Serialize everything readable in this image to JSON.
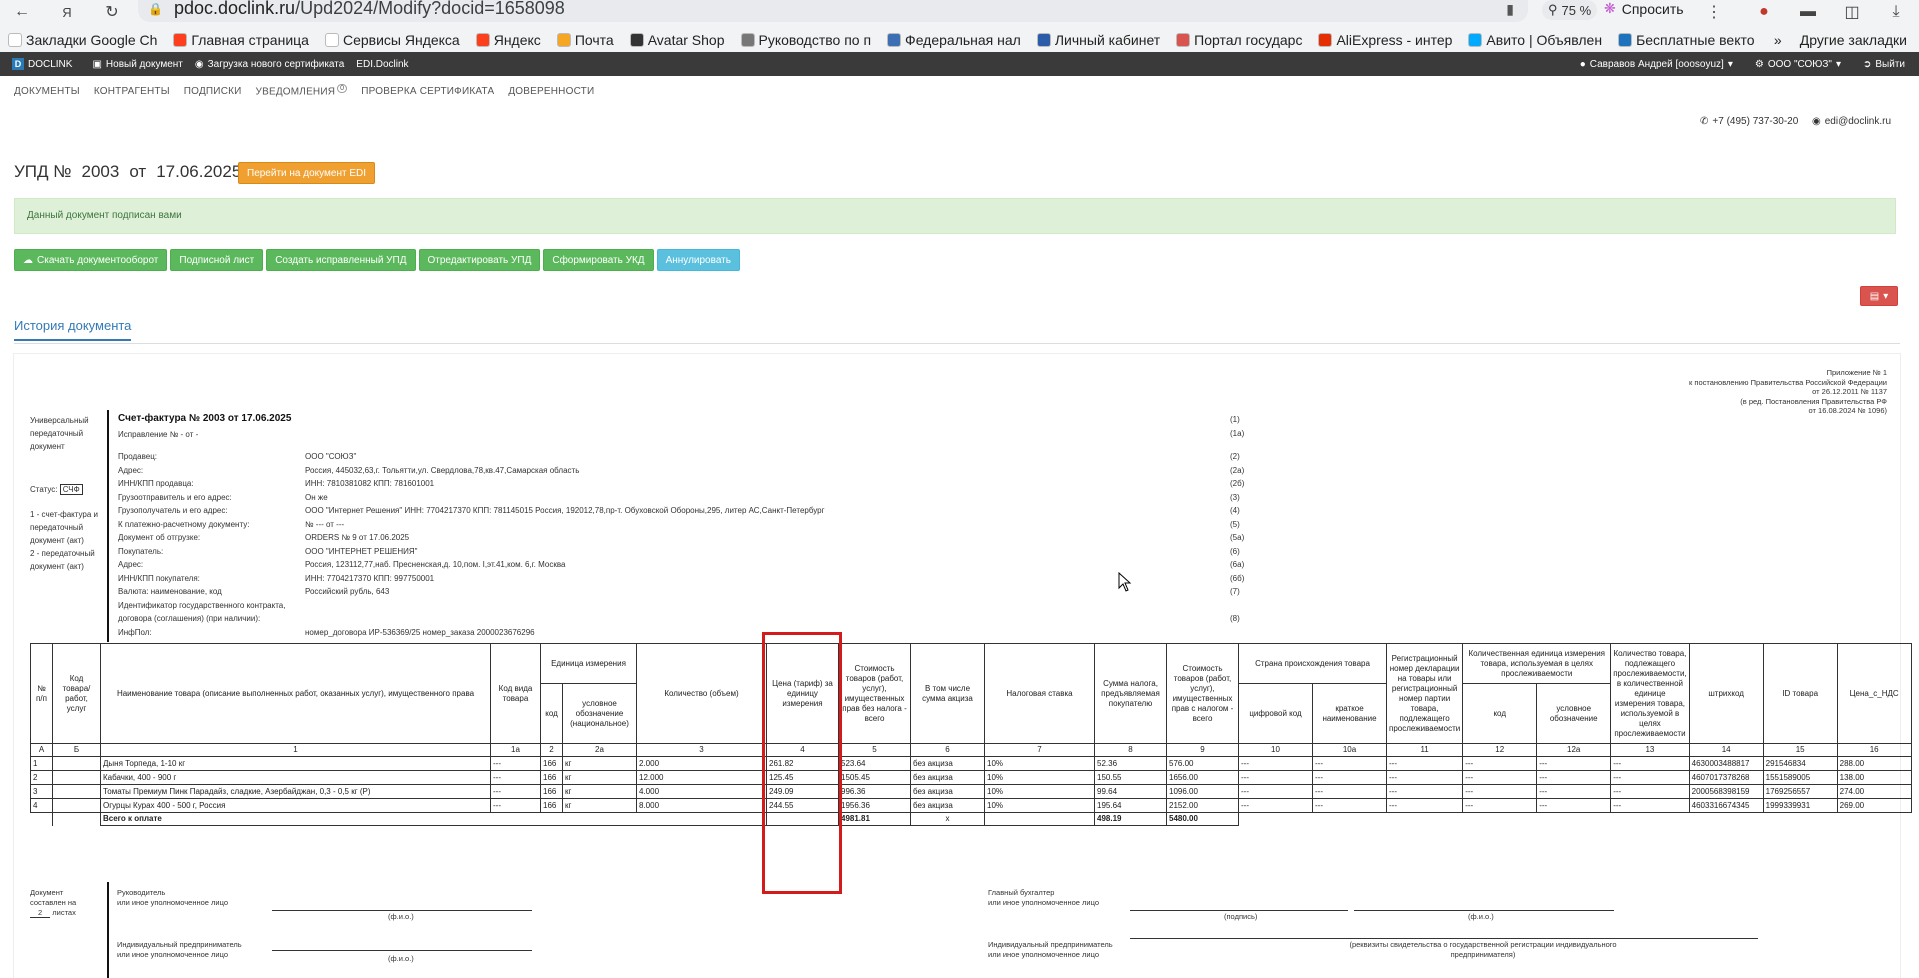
{
  "browser": {
    "url_host": "pdoc.doclink.ru",
    "url_path": "/Upd2024/Modify?docid=1658098",
    "zoom": "75 %",
    "ask_label": "Спросить",
    "bookmarks": [
      {
        "label": "Закладки Google Ch",
        "color": "#ffffff"
      },
      {
        "label": "Главная страница",
        "color": "#fc3f1d"
      },
      {
        "label": "Сервисы Яндекса",
        "color": "#ffffff"
      },
      {
        "label": "Яндекс",
        "color": "#fc3f1d"
      },
      {
        "label": "Почта",
        "color": "#f5a623"
      },
      {
        "label": "Avatar Shop",
        "color": "#333333"
      },
      {
        "label": "Руководство по п",
        "color": "#777777"
      },
      {
        "label": "Федеральная нал",
        "color": "#3c6eb4"
      },
      {
        "label": "Личный кабинет",
        "color": "#2a5caa"
      },
      {
        "label": "Портал государс",
        "color": "#d9534f"
      },
      {
        "label": "AliExpress - интер",
        "color": "#e62e04"
      },
      {
        "label": "Авито | Объявлен",
        "color": "#00aaff"
      },
      {
        "label": "Бесплатные векто",
        "color": "#1e73be"
      }
    ],
    "other_bookmarks": "Другие закладки"
  },
  "app": {
    "logo": "DOCLINK",
    "top_links": [
      "Новый документ",
      "Загрузка нового сертификата",
      "EDI.Doclink"
    ],
    "user": "Савравов Андрей [ooosoyuz]",
    "org": "ООО \"СОЮЗ\"",
    "logout": "Выйти",
    "menu": [
      "ДОКУМЕНТЫ",
      "КОНТРАГЕНТЫ",
      "ПОДПИСКИ",
      "УВЕДОМЛЕНИЯ",
      "ПРОВЕРКА СЕРТИФИКАТА",
      "ДОВЕРЕННОСТИ"
    ],
    "notifications_count": "0",
    "phone": "+7 (495) 737-30-20",
    "email": "edi@doclink.ru"
  },
  "doc": {
    "type": "УПД №",
    "number": "2003",
    "from": "от",
    "date": "17.06.2025",
    "goto_button": "Перейти на документ EDI",
    "alert": "Данный документ подписан вами",
    "actions": [
      {
        "label": "Скачать документооборот",
        "style": "g",
        "icon": "cloud-download-icon"
      },
      {
        "label": "Подписной лист",
        "style": "g"
      },
      {
        "label": "Создать исправленный УПД",
        "style": "g"
      },
      {
        "label": "Отредактировать УПД",
        "style": "g"
      },
      {
        "label": "Сформировать УКД",
        "style": "g"
      },
      {
        "label": "Аннулировать",
        "style": "b"
      }
    ],
    "history_tab": "История документа"
  },
  "invoice": {
    "appendix": [
      "Приложение № 1",
      "к постановлению Правительства Российской Федерации",
      "от 26.12.2011 № 1137",
      "(в ред. Постановления Правительства РФ",
      "от 16.08.2024 № 1096)"
    ],
    "side_label": "Универсальный передаточный документ",
    "status_label": "Статус:",
    "status_value": "СЧФ",
    "status_legend": [
      "1 - счет-фактура и передаточный документ (акт)",
      "2 - передаточный документ (акт)"
    ],
    "title": "Счет-фактура № 2003  от 17.06.2025",
    "correction": "Исправление № - от -",
    "fields": [
      {
        "label": "Продавец:",
        "value": "ООО \"СОЮЗ\"",
        "code": "(2)"
      },
      {
        "label": "Адрес:",
        "value": "Россия, 445032,63,г. Тольятти,ул. Свердлова,78,кв.47,Самарская область",
        "code": "(2а)"
      },
      {
        "label": "ИНН/КПП продавца:",
        "value": "ИНН: 7810381082 КПП: 781601001",
        "code": "(2б)"
      },
      {
        "label": "Грузоотправитель и его адрес:",
        "value": "Он же",
        "code": "(3)"
      },
      {
        "label": "Грузополучатель и его адрес:",
        "value": "ООО \"Интернет Решения\" ИНН: 7704217370 КПП: 781145015 Россия, 192012,78,пр-т. Обуховской Обороны,295, литер АС,Санкт-Петербург",
        "code": "(4)"
      },
      {
        "label": "К платежно-расчетному документу:",
        "value": "№   ---  от   ---",
        "code": "(5)"
      },
      {
        "label": "Документ об отгрузке:",
        "value": "ORDERS  № 9  от 17.06.2025",
        "code": "(5а)"
      },
      {
        "label": "Покупатель:",
        "value": "ООО \"ИНТЕРНЕТ РЕШЕНИЯ\"",
        "code": "(6)"
      },
      {
        "label": "Адрес:",
        "value": "Россия, 123112,77,наб. Пресненская,д. 10,пом. I,эт.41,ком. 6,г. Москва",
        "code": "(6а)"
      },
      {
        "label": "ИНН/КПП покупателя:",
        "value": "ИНН: 7704217370 КПП: 997750001",
        "code": "(6б)"
      },
      {
        "label": "Валюта: наименование, код",
        "value": "Российский рубль,  643",
        "code": "(7)"
      },
      {
        "label": "Идентификатор государственного контракта,",
        "value": "",
        "code": ""
      },
      {
        "label": "договора (соглашения) (при наличии):",
        "value": "",
        "code": "(8)"
      },
      {
        "label": "ИнфПол:",
        "value": "номер_договора ИР-536369/25 номер_заказа 2000023676296",
        "code": ""
      }
    ],
    "code_1": "(1)",
    "code_1a": "(1а)",
    "headers": {
      "n": "№ п/п",
      "kod": "Код товара/ работ, услуг",
      "name": "Наименование товара (описание выполненных работ, оказанных услуг), имущественного права",
      "kodvida": "Код вида товара",
      "unit": "Единица измерения",
      "unit_code": "код",
      "unit_name": "условное обозначение (национальное)",
      "qty": "Количество (объем)",
      "price": "Цена (тариф) за единицу измерения",
      "cost": "Стоимость товаров (работ, услуг), имущественных прав без налога - всего",
      "excise": "В том числе сумма акциза",
      "rate": "Налоговая ставка",
      "tax": "Сумма налога, предъявляемая покупателю",
      "total": "Стоимость товаров (работ, услуг), имущественных прав с налогом - всего",
      "country": "Страна происхождения товара",
      "country_code": "цифровой код",
      "country_name": "краткое наименование",
      "regnum": "Регистрационный номер декларации на товары или регистрационный номер партии товара, подлежащего прослеживаемости",
      "trace_unit": "Количественная единица измерения товара, используемая в целях прослеживаемости",
      "trace_code": "код",
      "trace_name": "условное обозначение",
      "trace_qty": "Количество товара, подлежащего прослеживаемости, в количественной единице измерения товара, используемой в целях прослеживаемости",
      "barcode": "штрихкод",
      "id": "ID товара",
      "price_vat": "Цена_с_НДС"
    },
    "col_numbers": [
      "А",
      "Б",
      "1",
      "1а",
      "2",
      "2а",
      "3",
      "4",
      "5",
      "6",
      "7",
      "8",
      "9",
      "10",
      "10а",
      "11",
      "12",
      "12а",
      "13",
      "14",
      "15",
      "16"
    ],
    "rows": [
      {
        "n": "1",
        "kod": "",
        "name": "Дыня Торпеда, 1-10 кг",
        "kodvida": "---",
        "ucode": "166",
        "uname": "кг",
        "qty": "2.000",
        "price": "261.82",
        "cost": "523.64",
        "excise": "без акциза",
        "rate": "10%",
        "tax": "52.36",
        "total": "576.00",
        "cc": "---",
        "cn": "---",
        "reg": "---",
        "tc": "---",
        "tn": "---",
        "tq": "---",
        "barcode": "4630003488817",
        "id": "291546834",
        "pv": "288.00"
      },
      {
        "n": "2",
        "kod": "",
        "name": "Кабачки, 400 - 900 г",
        "kodvida": "---",
        "ucode": "166",
        "uname": "кг",
        "qty": "12.000",
        "price": "125.45",
        "cost": "1505.45",
        "excise": "без акциза",
        "rate": "10%",
        "tax": "150.55",
        "total": "1656.00",
        "cc": "---",
        "cn": "---",
        "reg": "---",
        "tc": "---",
        "tn": "---",
        "tq": "---",
        "barcode": "4607017378268",
        "id": "1551589005",
        "pv": "138.00"
      },
      {
        "n": "3",
        "kod": "",
        "name": "Томаты Премиум Пинк Парадайз, сладкие, Азербайджан, 0,3 - 0,5 кг (Р)",
        "kodvida": "---",
        "ucode": "166",
        "uname": "кг",
        "qty": "4.000",
        "price": "249.09",
        "cost": "996.36",
        "excise": "без акциза",
        "rate": "10%",
        "tax": "99.64",
        "total": "1096.00",
        "cc": "---",
        "cn": "---",
        "reg": "---",
        "tc": "---",
        "tn": "---",
        "tq": "---",
        "barcode": "2000568398159",
        "id": "1769256557",
        "pv": "274.00"
      },
      {
        "n": "4",
        "kod": "",
        "name": "Огурцы Курах 400 - 500 г, Россия",
        "kodvida": "---",
        "ucode": "166",
        "uname": "кг",
        "qty": "8.000",
        "price": "244.55",
        "cost": "1956.36",
        "excise": "без акциза",
        "rate": "10%",
        "tax": "195.64",
        "total": "2152.00",
        "cc": "---",
        "cn": "---",
        "reg": "---",
        "tc": "---",
        "tn": "---",
        "tq": "---",
        "barcode": "4603316674345",
        "id": "1999339931",
        "pv": "269.00"
      }
    ],
    "total_label": "Всего к оплате",
    "total_cost": "4981.81",
    "total_excise": "х",
    "total_tax": "498.19",
    "total_sum": "5480.00",
    "signatures": {
      "doc_sheets": "Документ составлен на",
      "sheets_count": "2",
      "sheets_label": "листах",
      "head": "Руководитель",
      "head_sub": "или иное уполномоченное лицо",
      "fio": "(ф.и.о.)",
      "accountant": "Главный бухгалтер",
      "accountant_sub": "или иное уполномоченное лицо",
      "sign": "(подпись)",
      "ip": "Индивидуальный предприниматель",
      "ip_sub": "или иное уполномоченное лицо",
      "ip_req": "(реквизиты свидетельства о государственной регистрации индивидуального предпринимателя)"
    }
  },
  "colors": {
    "highlight": "#d31b1b",
    "green": "#5cb85c",
    "blue": "#5bc0de",
    "orange": "#f0a030"
  }
}
